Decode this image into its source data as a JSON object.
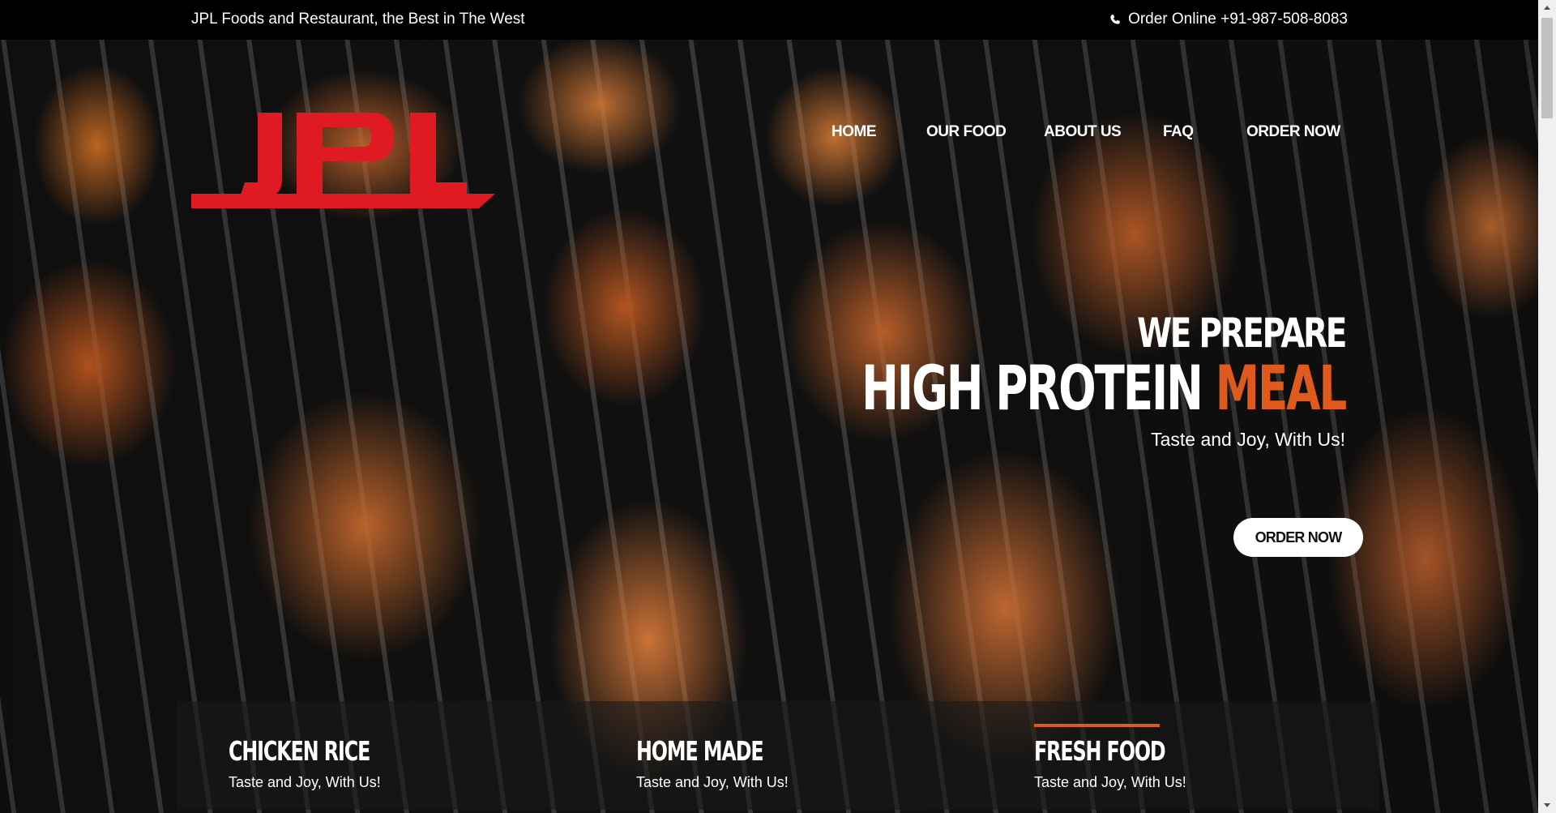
{
  "topbar": {
    "tagline": "JPL Foods and Restaurant, the Best in The West",
    "order_text": "Order Online +91-987-508-8083",
    "phone_icon": "phone-icon"
  },
  "logo": {
    "text": "JPL",
    "color": "#e01a22"
  },
  "nav": {
    "items": [
      "HOME",
      "OUR FOOD",
      "ABOUT US",
      "FAQ",
      "ORDER NOW"
    ]
  },
  "hero": {
    "line1": "WE PREPARE",
    "line2_main": "HIGH PROTEIN",
    "line2_accent": "MEAL",
    "line3": "Taste and Joy, With Us!",
    "cta": "ORDER NOW",
    "accent_color": "#e05a1e"
  },
  "features": [
    {
      "title": "CHICKEN RICE",
      "subtitle": "Taste and Joy, With Us!"
    },
    {
      "title": "HOME MADE",
      "subtitle": "Taste and Joy, With Us!"
    },
    {
      "title": "FRESH FOOD",
      "subtitle": "Taste and Joy, With Us!",
      "active": true
    }
  ]
}
